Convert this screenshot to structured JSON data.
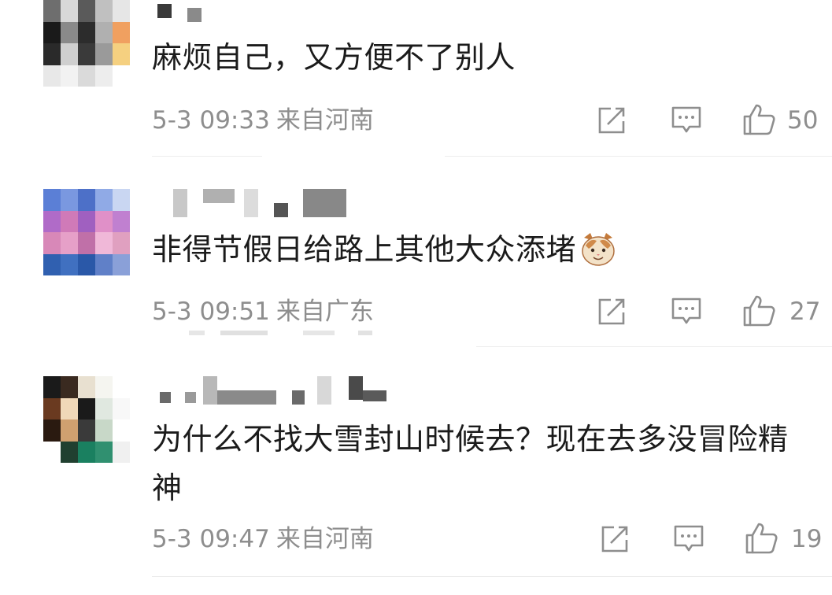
{
  "comments": [
    {
      "text": "麻烦自己，又方便不了别人",
      "date": "5-3 09:33",
      "location": "来自河南",
      "likes": "50",
      "avatar_colors": [
        [
          "#6e6e6e",
          "#d8d8d8",
          "#5a5a5a",
          "#c0c0c0",
          "#e6e6e6"
        ],
        [
          "#1a1a1a",
          "#8a8a8a",
          "#2c2c2c",
          "#b0b0b0",
          "#f0a060"
        ],
        [
          "#2a2a2a",
          "#cfcfcf",
          "#3a3a3a",
          "#9a9a9a",
          "#f5d080"
        ],
        [
          "#e8e8e8",
          "#f2f2f2",
          "#dadada",
          "#ededed",
          "#ffffff"
        ]
      ]
    },
    {
      "text": "非得节假日给路上其他大众添堵",
      "emoji": "cat-emoji",
      "date": "5-3 09:51",
      "location": "来自广东",
      "likes": "27",
      "avatar_colors": [
        [
          "#5b7fd6",
          "#7a98e0",
          "#4d70c8",
          "#90aae6",
          "#c9d6f2"
        ],
        [
          "#b06bc8",
          "#d07ab8",
          "#a060c0",
          "#e090c8",
          "#c080d0"
        ],
        [
          "#d888b8",
          "#e6a0c8",
          "#c070a8",
          "#f0b8d8",
          "#e0a0c0"
        ],
        [
          "#3060b0",
          "#4070c0",
          "#2a58a8",
          "#6080c8",
          "#8aa0d8"
        ]
      ]
    },
    {
      "text": "为什么不找大雪封山时候去？现在去多没冒险精神",
      "date": "5-3 09:47",
      "location": "来自河南",
      "likes": "19",
      "avatar_colors": [
        [
          "#1a1a1a",
          "#3a2a20",
          "#e8e0d0",
          "#f5f5f0",
          "#ffffff"
        ],
        [
          "#6a3a20",
          "#f0d8b8",
          "#1a1a1a",
          "#e0e8e0",
          "#f8f8f8"
        ],
        [
          "#2a1a10",
          "#d0a070",
          "#3a3a3a",
          "#c8d8c8",
          "#ffffff"
        ],
        [
          "#ffffff",
          "#204030",
          "#1a8060",
          "#309070",
          "#f0f0f0"
        ]
      ]
    }
  ]
}
